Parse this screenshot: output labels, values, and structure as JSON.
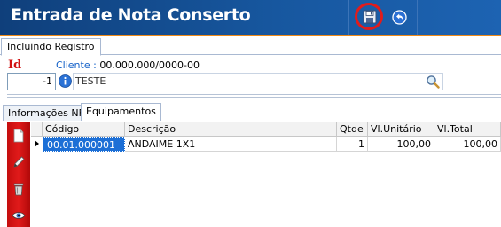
{
  "window": {
    "title": "Entrada de Nota Conserto"
  },
  "toolbar": {
    "save_icon": "save-disk-icon",
    "back_icon": "undo-icon"
  },
  "top_tab": {
    "label": "Incluindo Registro"
  },
  "form": {
    "id_label": "Id",
    "id_value": "-1",
    "cliente_label": "Cliente :",
    "cliente_doc": "00.000.000/0000-00",
    "cliente_value": "TESTE"
  },
  "tabs": [
    {
      "label": "Informações NF",
      "active": false
    },
    {
      "label": "Equipamentos",
      "active": true
    }
  ],
  "grid": {
    "columns": [
      "Código",
      "Descrição",
      "Qtde",
      "Vl.Unitário",
      "Vl.Total"
    ],
    "rows": [
      [
        "00.01.000001",
        "ANDAIME 1X1",
        "1",
        "100,00",
        "100,00"
      ]
    ]
  },
  "colors": {
    "title_bg": "#17579f",
    "accent": "#f08a16",
    "sidebar": "#d01414",
    "selection": "#1c6fd6"
  }
}
